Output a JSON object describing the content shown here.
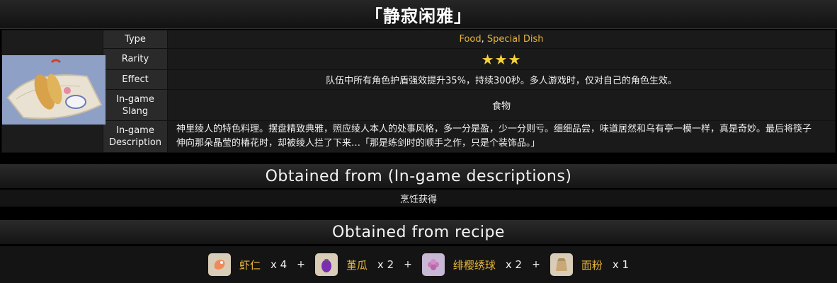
{
  "title": "「静寂闲雅」",
  "info": {
    "type_label": "Type",
    "type_value_1": "Food",
    "type_sep": ", ",
    "type_value_2": "Special Dish",
    "rarity_label": "Rarity",
    "rarity_stars": 3,
    "rarity_display": "★★★",
    "effect_label": "Effect",
    "effect_value": "队伍中所有角色护盾强效提升35%，持续300秒。多人游戏时，仅对自己的角色生效。",
    "slang_label_1": "In-game",
    "slang_label_2": "Slang",
    "slang_value": "食物",
    "desc_label_1": "In-game",
    "desc_label_2": "Description",
    "desc_line_1": "神里绫人的特色料理。摆盘精致典雅，照应绫人本人的处事风格，多一分是盈，少一分则亏。细细品尝，味道居然和乌有亭一模一样，真是奇妙。最后将筷子",
    "desc_line_2": "伸向那朵晶莹的椿花时，却被绫人拦了下来…「那是练剑时的顺手之作，只是个装饰品。」"
  },
  "obtained_desc": {
    "heading": "Obtained from (In-game descriptions)",
    "value": "烹饪获得"
  },
  "recipe": {
    "heading": "Obtained from recipe",
    "plus": "+",
    "ingredients": [
      {
        "name": "虾仁",
        "qty": "x 4",
        "icon": "shrimp-icon"
      },
      {
        "name": "堇瓜",
        "qty": "x 2",
        "icon": "eggplant-icon"
      },
      {
        "name": "绯樱绣球",
        "qty": "x 2",
        "icon": "sakura-flower-icon"
      },
      {
        "name": "面粉",
        "qty": "x 1",
        "icon": "flour-sack-icon"
      }
    ]
  },
  "colors": {
    "accent": "#e8b73a",
    "star": "#f5d23a",
    "background": "#000000"
  }
}
